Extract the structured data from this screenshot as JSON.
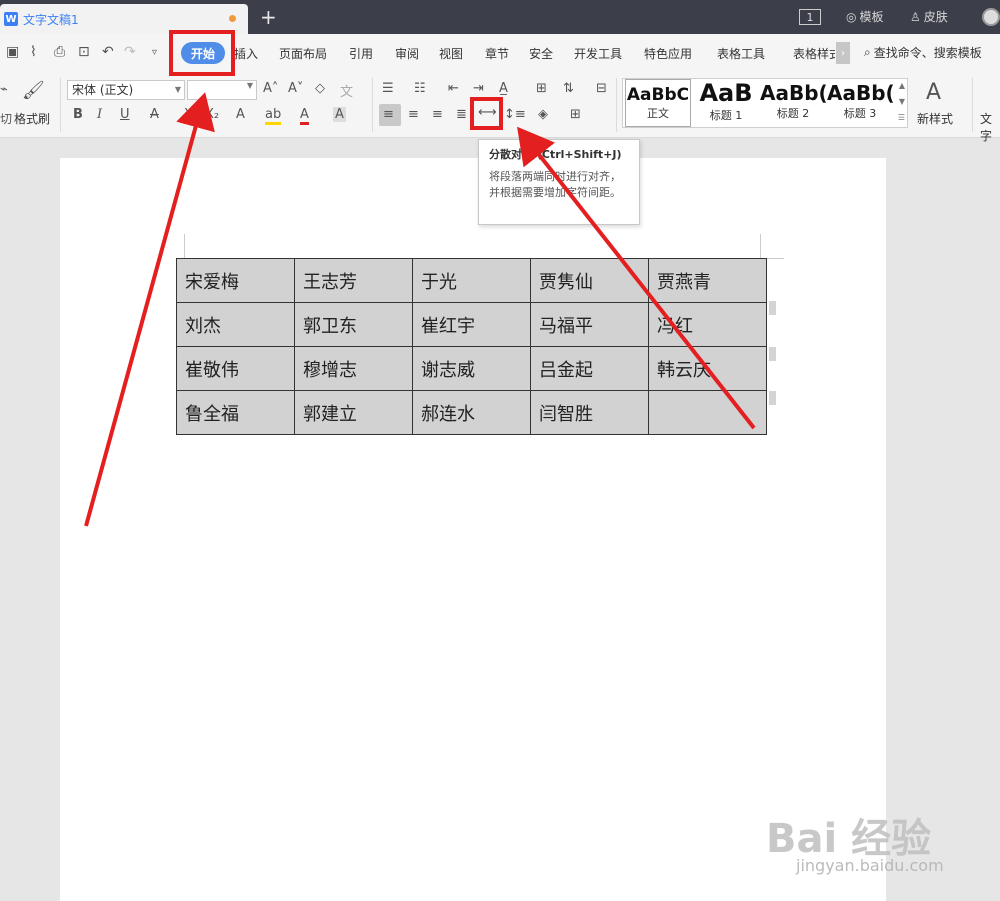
{
  "titlebar": {
    "doc_icon_letter": "W",
    "tab_title": "文字文稿1",
    "badge": "1",
    "templates": "模板",
    "skins": "皮肤"
  },
  "menubar": {
    "items": [
      "开始",
      "插入",
      "页面布局",
      "引用",
      "审阅",
      "视图",
      "章节",
      "安全",
      "开发工具",
      "特色应用",
      "表格工具",
      "表格样式"
    ],
    "search": "查找命令、搜索模板"
  },
  "ribbon": {
    "format_painter": "格式刷",
    "cut_partial": "切",
    "font_name": "宋体 (正文)",
    "font_size": "",
    "styles": [
      {
        "preview": "AaBbC",
        "name": "正文"
      },
      {
        "preview": "AaB",
        "name": "标题 1"
      },
      {
        "preview": "AaBb(",
        "name": "标题 2"
      },
      {
        "preview": "AaBb(",
        "name": "标题 3"
      }
    ],
    "new_style": "新样式",
    "text_tools_partial": "文字"
  },
  "tooltip": {
    "title": "分散对齐 (Ctrl+Shift+J)",
    "description": "将段落两端同时进行对齐，并根据需要增加字符间距。"
  },
  "table": {
    "rows": [
      [
        "宋爱梅",
        "王志芳",
        "于光",
        "贾隽仙",
        "贾燕青"
      ],
      [
        "刘杰",
        "郭卫东",
        "崔红宇",
        "马福平",
        "冯红"
      ],
      [
        "崔敬伟",
        "穆增志",
        "谢志威",
        "吕金起",
        "韩云庆"
      ],
      [
        "鲁全福",
        "郭建立",
        "郝连水",
        "闫智胜",
        ""
      ]
    ]
  },
  "watermark": {
    "logo": "Bai 经验",
    "url": "jingyan.baidu.com"
  },
  "colors": {
    "accent": "#4f8de8",
    "annotation_red": "#e41f1f",
    "table_fill": "#d2d2d2"
  }
}
